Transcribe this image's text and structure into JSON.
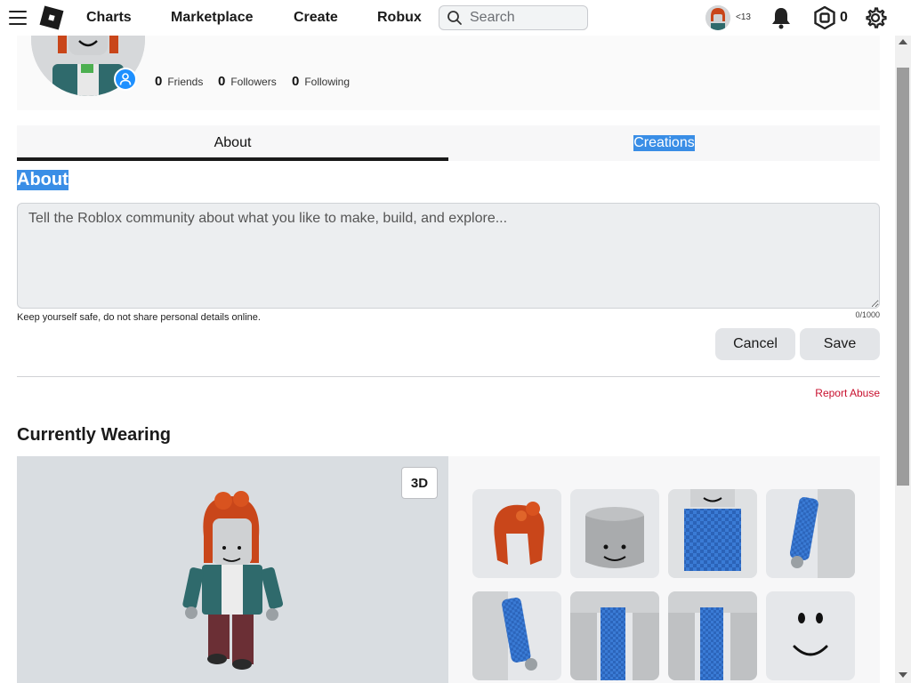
{
  "nav": {
    "links": [
      "Charts",
      "Marketplace",
      "Create",
      "Robux"
    ],
    "search_placeholder": "Search",
    "age_badge": "<13",
    "robux_count": "0"
  },
  "profile": {
    "friends_count": "0",
    "friends_label": "Friends",
    "followers_count": "0",
    "followers_label": "Followers",
    "following_count": "0",
    "following_label": "Following"
  },
  "tabs": {
    "about": "About",
    "creations": "Creations"
  },
  "about": {
    "title": "About",
    "placeholder": "Tell the Roblox community about what you like to make, build, and explore...",
    "safety_note": "Keep yourself safe, do not share personal details online.",
    "char_count": "0/1000",
    "cancel": "Cancel",
    "save": "Save",
    "report_abuse": "Report Abuse"
  },
  "wearing": {
    "title": "Currently Wearing",
    "view_toggle": "3D",
    "items": [
      "hair",
      "head",
      "shirt",
      "right-arm",
      "left-arm",
      "left-leg",
      "right-leg",
      "face"
    ]
  },
  "colors": {
    "accent_red": "#c8102e",
    "selection_blue": "#3a8ee6",
    "badge_blue": "#1e90ff",
    "hair_orange": "#c9461a",
    "shirt_blue": "#3a7bd5"
  }
}
